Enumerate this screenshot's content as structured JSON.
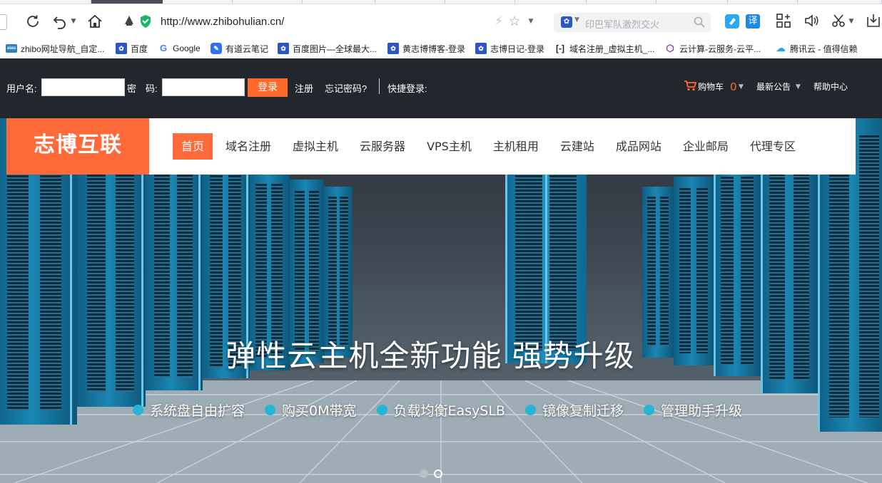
{
  "browser": {
    "url": "http://www.zhibohulian.cn/",
    "search_placeholder": "印巴军队激烈交火",
    "engine_icon": "baidu-paw-icon",
    "accent": "#4a4f57"
  },
  "bookmarks": [
    {
      "label": "zhibo网址导航_自定...",
      "icon": "zhibo-icon",
      "color": "#2f7fc6"
    },
    {
      "label": "百度",
      "icon": "baidu-paw-icon",
      "color": "#2b56c6"
    },
    {
      "label": "Google",
      "icon": "google-icon",
      "color": "#ffffff"
    },
    {
      "label": "有道云笔记",
      "icon": "youdao-note-icon",
      "color": "#2f6ff0"
    },
    {
      "label": "百度图片—全球最大...",
      "icon": "baidu-paw-icon",
      "color": "#2b56c6"
    },
    {
      "label": "黄志博博客-登录",
      "icon": "baidu-paw-icon",
      "color": "#2b56c6"
    },
    {
      "label": "志博日记-登录",
      "icon": "baidu-paw-icon",
      "color": "#2b56c6"
    },
    {
      "label": "域名注册_虚拟主机_...",
      "icon": "bracket-logo-icon",
      "color": "#222222"
    },
    {
      "label": "云计算-云服务-云平...",
      "icon": "cube-icon",
      "color": "#7a3dbd"
    },
    {
      "label": "腾讯云 - 值得信赖",
      "icon": "tencent-cloud-icon",
      "color": "#2ba3f0"
    }
  ],
  "login_bar": {
    "username_label": "用户名:",
    "password_label": "密　码:",
    "login_button": "登录",
    "register_link": "注册",
    "forgot_link": "忘记密码?",
    "quick_login": "快捷登录:",
    "cart_label": "购物车",
    "cart_count": "0",
    "announcements": "最新公告",
    "help": "帮助中心",
    "accent": "#ff6a2c"
  },
  "nav": {
    "logo": "志博互联",
    "items": [
      "首页",
      "域名注册",
      "虚拟主机",
      "云服务器",
      "VPS主机",
      "主机租用",
      "云建站",
      "成品网站",
      "企业邮局",
      "代理专区"
    ],
    "active_index": 0
  },
  "hero": {
    "title": "弹性云主机全新功能  强势升级",
    "features": [
      "系统盘自由扩容",
      "购买0M带宽",
      "负载均衡EasySLB",
      "镜像复制迁移",
      "管理助手升级"
    ],
    "bullet_color": "#26b5d6",
    "slides": 2,
    "active_slide": 1
  }
}
